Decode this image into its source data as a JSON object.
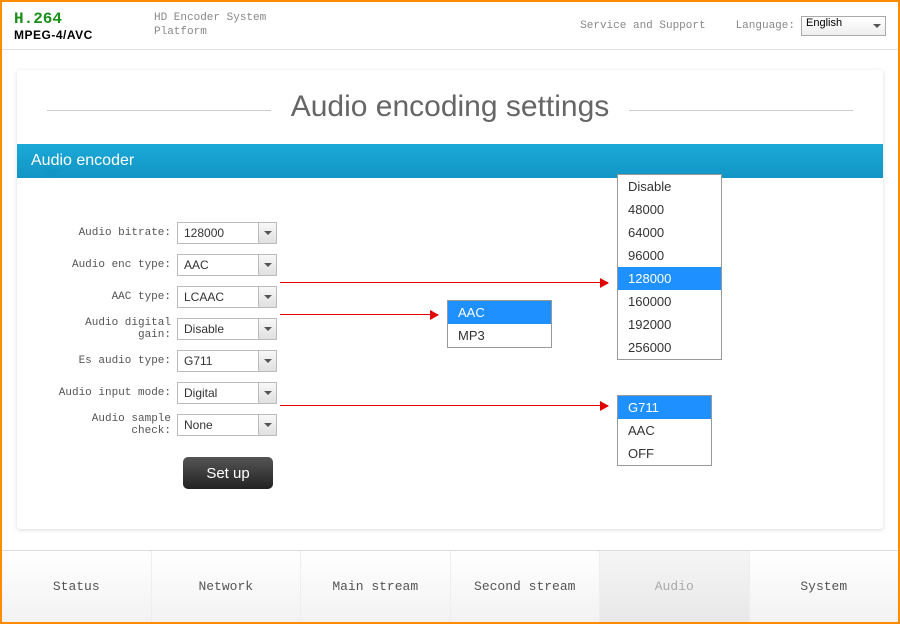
{
  "header": {
    "logo_top": "H.264",
    "logo_bottom": "MPEG-4/AVC",
    "subtitle_line1": "HD Encoder System",
    "subtitle_line2": "Platform",
    "service": "Service and Support",
    "lang_label": "Language:",
    "lang_value": "English"
  },
  "page_title": "Audio encoding settings",
  "section_title": "Audio encoder",
  "form": {
    "bitrate": {
      "label": "Audio bitrate:",
      "value": "128000"
    },
    "enc_type": {
      "label": "Audio enc type:",
      "value": "AAC"
    },
    "aac_type": {
      "label": "AAC type:",
      "value": "LCAAC"
    },
    "gain": {
      "label": "Audio digital gain:",
      "value": "Disable"
    },
    "es_type": {
      "label": "Es audio type:",
      "value": "G711"
    },
    "input_mode": {
      "label": "Audio input mode:",
      "value": "Digital"
    },
    "sample_check": {
      "label": "Audio sample check:",
      "value": "None"
    }
  },
  "setup_button": "Set up",
  "popup_bitrate": {
    "options": [
      "Disable",
      "48000",
      "64000",
      "96000",
      "128000",
      "160000",
      "192000",
      "256000"
    ],
    "selected": "128000"
  },
  "popup_enc": {
    "options": [
      "AAC",
      "MP3"
    ],
    "selected": "AAC"
  },
  "popup_es": {
    "options": [
      "G711",
      "AAC",
      "OFF"
    ],
    "selected": "G711"
  },
  "footer_tabs": [
    "Status",
    "Network",
    "Main stream",
    "Second stream",
    "Audio",
    "System"
  ],
  "footer_active": "Audio"
}
